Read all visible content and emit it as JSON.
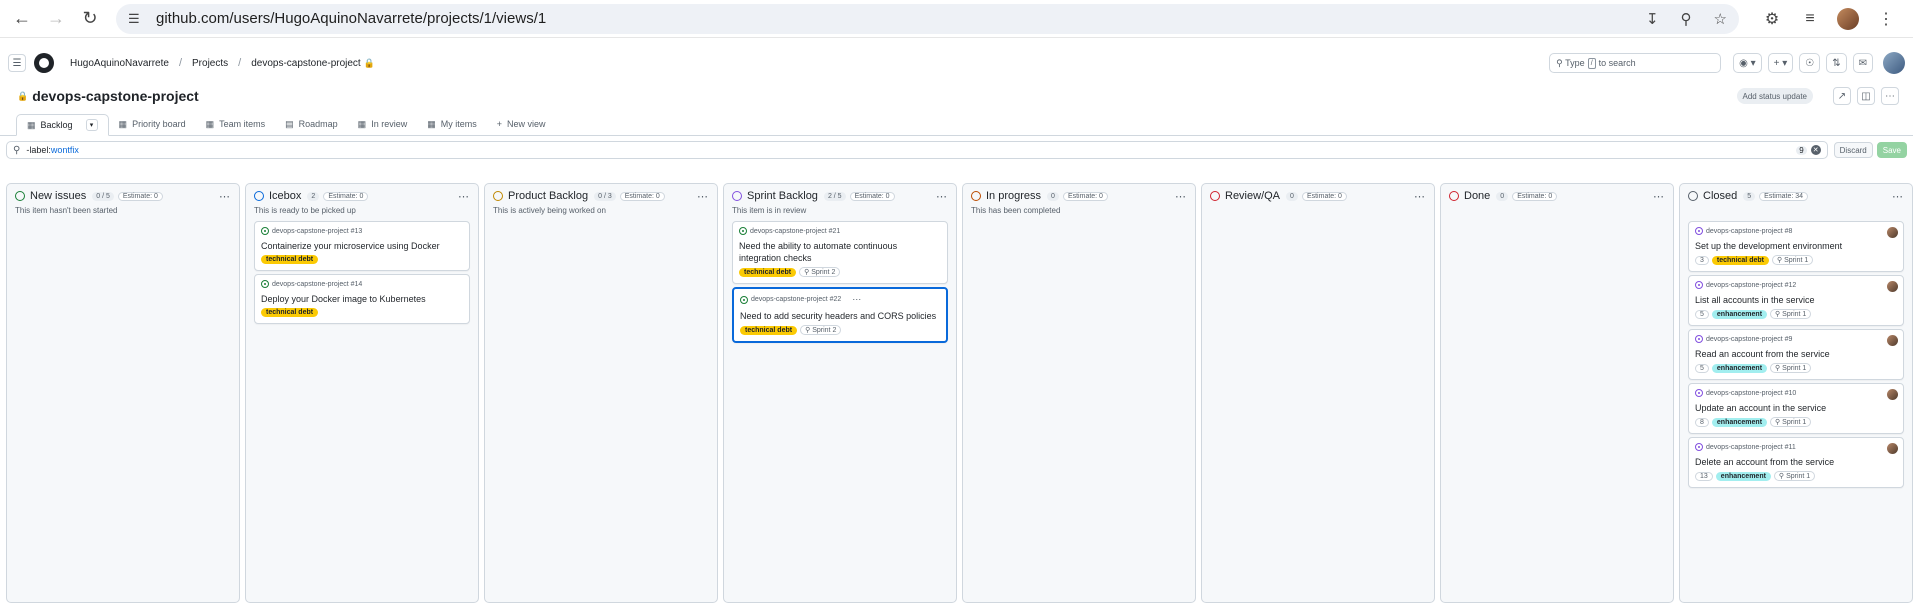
{
  "browser": {
    "url": "github.com/users/HugoAquinoNavarrete/projects/1/views/1"
  },
  "header": {
    "breadcrumbs": [
      "HugoAquinoNavarrete",
      "Projects",
      "devops-capstone-project"
    ],
    "search_placeholder_pre": "Type",
    "search_key": "/",
    "search_placeholder_post": "to search"
  },
  "project": {
    "title": "devops-capstone-project",
    "status_button": "Add status update"
  },
  "tabs": [
    {
      "label": "Backlog"
    },
    {
      "label": "Priority board"
    },
    {
      "label": "Team items"
    },
    {
      "label": "Roadmap"
    },
    {
      "label": "In review"
    },
    {
      "label": "My items"
    },
    {
      "label": "New view"
    }
  ],
  "filter": {
    "keyword": "-label:",
    "value": "wontfix",
    "count": "9",
    "discard": "Discard",
    "save": "Save"
  },
  "columns": [
    {
      "name": "New issues",
      "count": "0 / 5",
      "estimate": "Estimate: 0",
      "desc": "This item hasn't been started",
      "color": "#1a7f37",
      "cards": []
    },
    {
      "name": "Icebox",
      "count": "2",
      "estimate": "Estimate: 0",
      "desc": "This is ready to be picked up",
      "color": "#0969da",
      "cards": [
        {
          "ref": "devops-capstone-project #13",
          "title": "Containerize your microservice using Docker",
          "label": "technical debt"
        },
        {
          "ref": "devops-capstone-project #14",
          "title": "Deploy your Docker image to Kubernetes",
          "label": "technical debt"
        }
      ]
    },
    {
      "name": "Product Backlog",
      "count": "0 / 3",
      "estimate": "Estimate: 0",
      "desc": "This is actively being worked on",
      "color": "#bf8700",
      "cards": []
    },
    {
      "name": "Sprint Backlog",
      "count": "2 / 5",
      "estimate": "Estimate: 0",
      "desc": "This item is in review",
      "color": "#8250df",
      "cards": [
        {
          "ref": "devops-capstone-project #21",
          "title": "Need the ability to automate continuous integration checks",
          "label": "technical debt",
          "sprint": "Sprint 2"
        },
        {
          "ref": "devops-capstone-project #22",
          "title": "Need to add security headers and CORS policies",
          "label": "technical debt",
          "sprint": "Sprint 2"
        }
      ]
    },
    {
      "name": "In progress",
      "count": "0",
      "estimate": "Estimate: 0",
      "desc": "This has been completed",
      "color": "#bc4c00",
      "cards": []
    },
    {
      "name": "Review/QA",
      "count": "0",
      "estimate": "Estimate: 0",
      "desc": "",
      "color": "#cf222e",
      "cards": []
    },
    {
      "name": "Done",
      "count": "0",
      "estimate": "Estimate: 0",
      "desc": "",
      "color": "#cf222e",
      "cards": []
    },
    {
      "name": "Closed",
      "count": "5",
      "estimate": "Estimate: 34",
      "desc": "",
      "color": "#57606a",
      "cards": [
        {
          "ref": "devops-capstone-project #8",
          "title": "Set up the development environment",
          "points": "3",
          "label": "technical debt",
          "sprint": "Sprint 1"
        },
        {
          "ref": "devops-capstone-project #12",
          "title": "List all accounts in the service",
          "points": "5",
          "label": "enhancement",
          "sprint": "Sprint 1"
        },
        {
          "ref": "devops-capstone-project #9",
          "title": "Read an account from the service",
          "points": "5",
          "label": "enhancement",
          "sprint": "Sprint 1"
        },
        {
          "ref": "devops-capstone-project #10",
          "title": "Update an account in the service",
          "points": "8",
          "label": "enhancement",
          "sprint": "Sprint 1"
        },
        {
          "ref": "devops-capstone-project #11",
          "title": "Delete an account from the service",
          "points": "13",
          "label": "enhancement",
          "sprint": "Sprint 1"
        }
      ]
    }
  ]
}
